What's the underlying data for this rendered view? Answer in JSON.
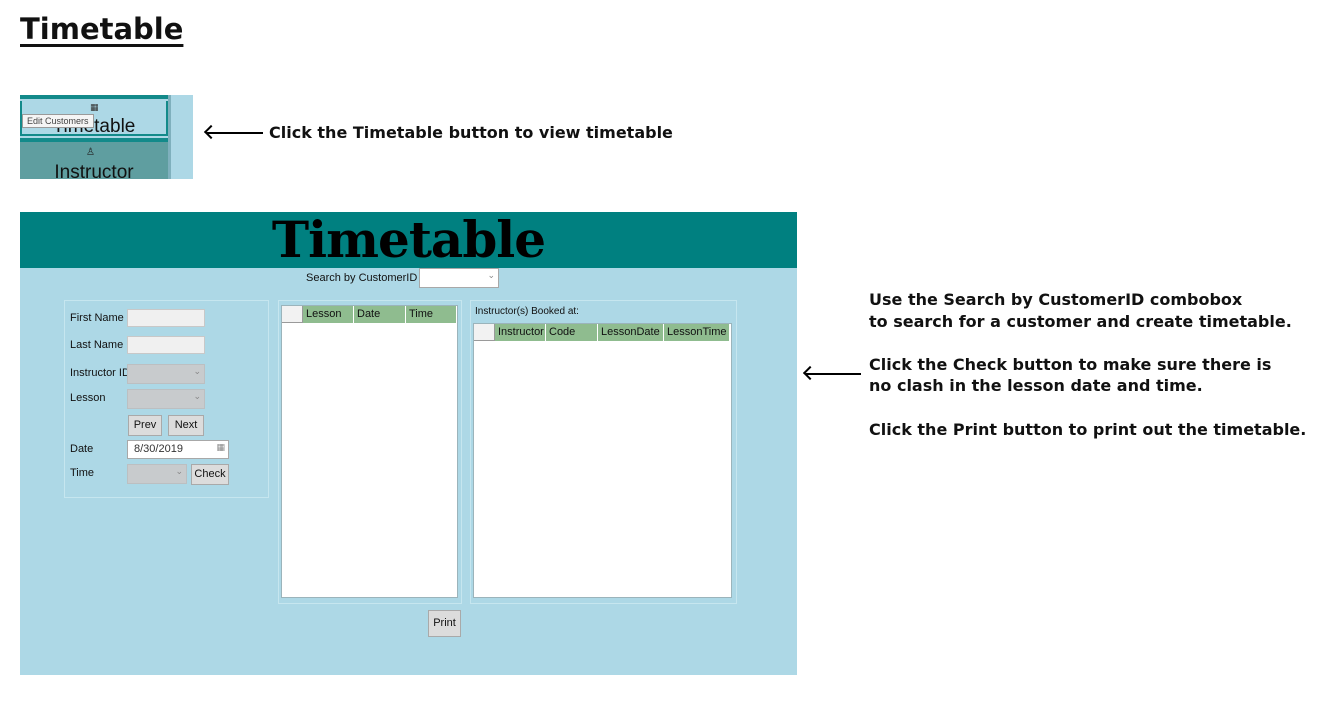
{
  "doc": {
    "title": "Timetable",
    "note_nav": "Click the Timetable button to view timetable",
    "note_search_1": "Use the Search by CustomerID combobox",
    "note_search_2": "to search for a customer and create timetable.",
    "note_check_1": "Click the Check button to make sure there is",
    "note_check_2": "no clash in the lesson date and time.",
    "note_print": "Click the Print button to print out the timetable."
  },
  "nav": {
    "tooltip": "Edit Customers",
    "timetable_label": "Timetable",
    "instructor_label": "Instructor",
    "timetable_icon": "calendar-icon",
    "instructor_icon": "person-car-icon"
  },
  "app": {
    "title": "Timetable",
    "search_label": "Search by CustomerID",
    "search_value": ""
  },
  "form": {
    "first_name_label": "First Name",
    "last_name_label": "Last Name",
    "instructor_id_label": "Instructor ID",
    "lesson_label": "Lesson",
    "prev_label": "Prev",
    "next_label": "Next",
    "date_label": "Date",
    "date_value": "8/30/2019",
    "time_label": "Time",
    "check_label": "Check"
  },
  "lesson_grid": {
    "columns": [
      "Lesson",
      "Date",
      "Time"
    ]
  },
  "booked_grid": {
    "caption": "Instructor(s) Booked at:",
    "columns": [
      "Instructor",
      "Code",
      "LessonDate",
      "LessonTime"
    ]
  },
  "print_label": "Print",
  "colors": {
    "header": "#008080",
    "app_bg": "#add8e6",
    "grid_header": "#8fbc8f"
  }
}
